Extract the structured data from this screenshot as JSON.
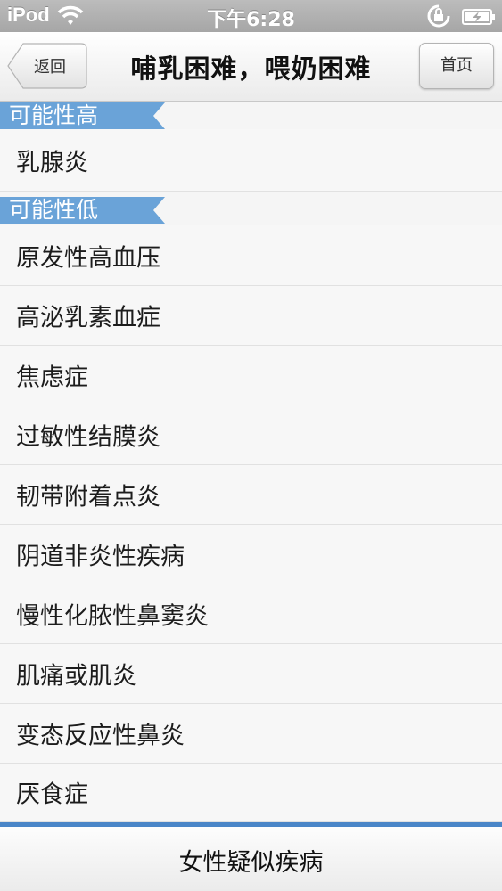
{
  "status_bar": {
    "carrier": "iPod",
    "time": "下午6:28"
  },
  "nav": {
    "back_label": "返回",
    "title": "哺乳困难，喂奶困难",
    "home_label": "首页"
  },
  "sections": {
    "high": {
      "label": "可能性高",
      "items": [
        "乳腺炎"
      ]
    },
    "low": {
      "label": "可能性低",
      "items": [
        "原发性高血压",
        "高泌乳素血症",
        "焦虑症",
        "过敏性结膜炎",
        "韧带附着点炎",
        "阴道非炎性疾病",
        "慢性化脓性鼻窦炎",
        "肌痛或肌炎",
        "变态反应性鼻炎",
        "厌食症"
      ]
    }
  },
  "tab_bar": {
    "label": "女性疑似疾病"
  },
  "colors": {
    "section_header": "#6aa3d8",
    "tab_accent": "#4a86c8"
  }
}
